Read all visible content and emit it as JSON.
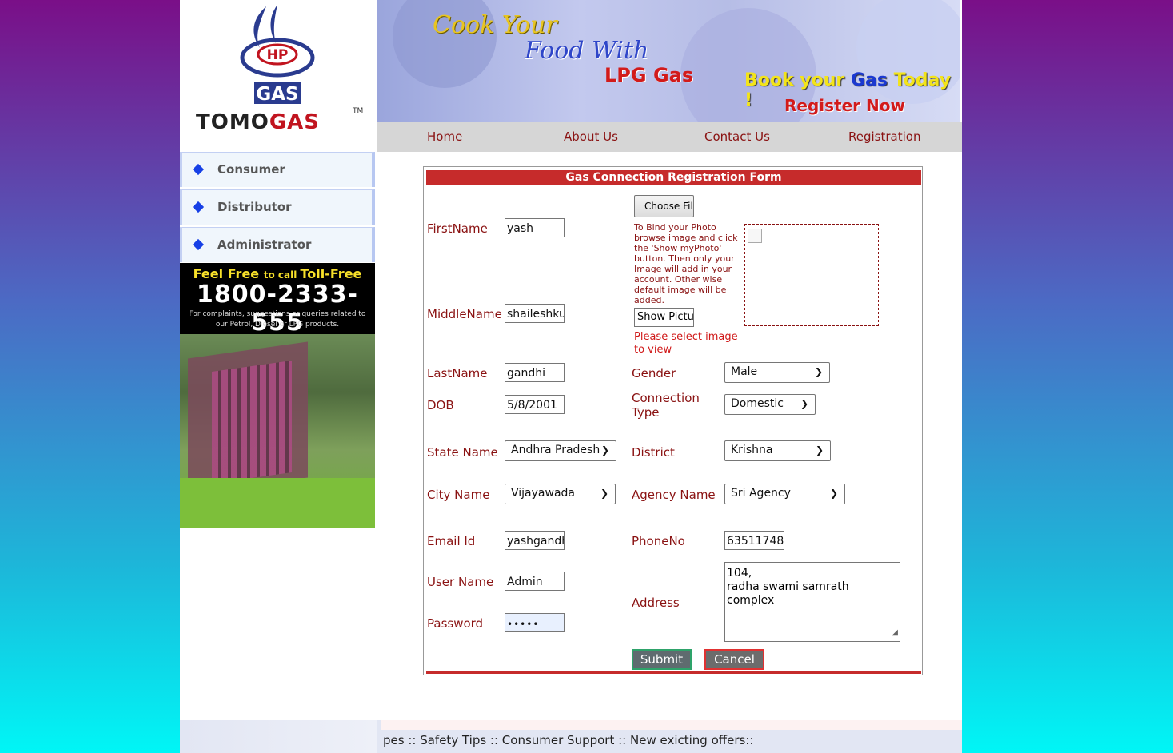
{
  "logo": {
    "brand": "GAS",
    "brand_top": "HP",
    "name_left": "TOMO",
    "name_right": "GAS",
    "tm": "TM"
  },
  "banner": {
    "line1": "Cook Your",
    "line2": "Food With",
    "line3": "LPG Gas",
    "line4_a": "Book your ",
    "line4_b": "Gas",
    "line4_c": " Today !",
    "line5": "Register Now"
  },
  "nav": [
    "Home",
    "About Us",
    "Contact Us",
    "Registration"
  ],
  "sidebar": {
    "items": [
      "Consumer",
      "Distributor",
      "Administrator"
    ]
  },
  "tollfree": {
    "line1_a": "Feel Free ",
    "line1_b": "to call ",
    "line1_c": "Toll-Free",
    "number": "1800-2333-555",
    "note": "For complaints, suggestions or queries related to our Petrol, Diesel or LPG products."
  },
  "form": {
    "title": "Gas Connection Registration Form",
    "labels": {
      "firstname": "FirstName",
      "middlename": "MiddleName",
      "lastname": "LastName",
      "dob": "DOB",
      "state": "State Name",
      "city": "City Name",
      "email": "Email Id",
      "username": "User Name",
      "password": "Password",
      "gender": "Gender",
      "connection_type": "Connection Type",
      "district": "District",
      "agency": "Agency Name",
      "phone": "PhoneNo",
      "address": "Address"
    },
    "values": {
      "firstname": "yash",
      "middlename": "shaileshku",
      "lastname": "gandhi",
      "dob": "5/8/2001",
      "state": "Andhra Pradesh",
      "city": "Vijayawada",
      "email": "yashgandh",
      "username": "Admin",
      "password": "•••••",
      "gender": "Male",
      "connection_type": "Domestic",
      "district": "Krishna",
      "agency": "Sri Agency",
      "phone": "63511748",
      "address": "104,\nradha swami samrath\ncomplex"
    },
    "choose_file": "Choose File",
    "photo_help": "To Bind your Photo browse image and click the 'Show myPhoto' button. Then only your Image will add in your account. Other wise default image will be added.",
    "show_picture": "Show Picture",
    "select_msg": "Please select image to view",
    "submit": "Submit",
    "cancel": "Cancel"
  },
  "footer": {
    "marquee": "pes :: Safety Tips :: Consumer Support :: New exicting offers::"
  },
  "colors": {
    "nav_text": "#8a1212",
    "form_header": "#c62b2b",
    "label": "#8a1212",
    "error": "#d01818"
  }
}
